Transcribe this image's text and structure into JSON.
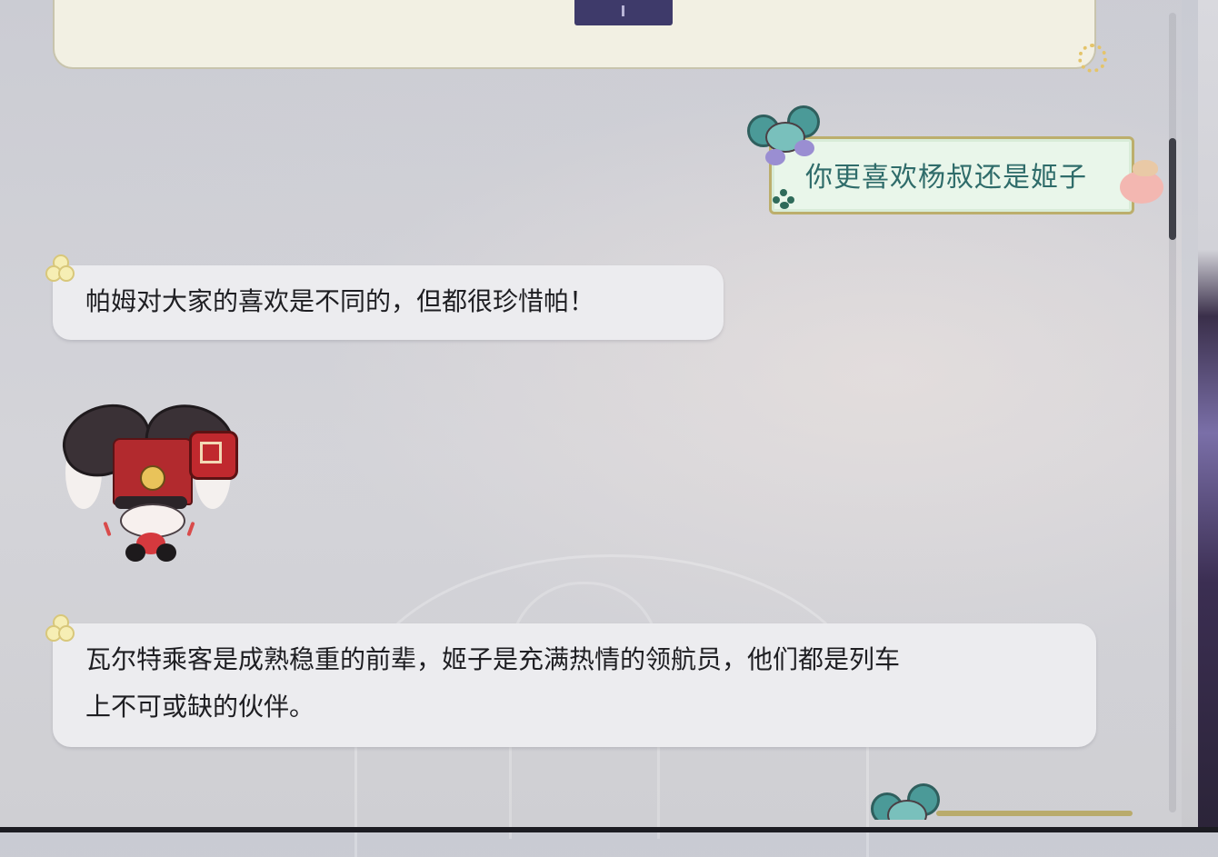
{
  "chat": {
    "user_messages": [
      {
        "text": "你更喜欢杨叔还是姬子"
      }
    ],
    "bot_messages": [
      {
        "text": "帕姆对大家的喜欢是不同的，但都很珍惜帕！"
      },
      {
        "line1": "瓦尔特乘客是成熟稳重的前辈，姬子是充满热情的领航员，他们都是列车",
        "line2": "上不可或缺的伙伴。"
      }
    ],
    "stickers": [
      "mouse-sticker",
      "pink-sticker",
      "conductor-sticker"
    ]
  },
  "colors": {
    "user_text": "#2f6c6a",
    "user_bubble_bg": "#e9f6ea",
    "user_bubble_border": "#bcae6c",
    "bot_bubble_bg": "#ececef",
    "top_card_bg": "#f2f0e3",
    "top_tab": "#3e3a6a"
  }
}
